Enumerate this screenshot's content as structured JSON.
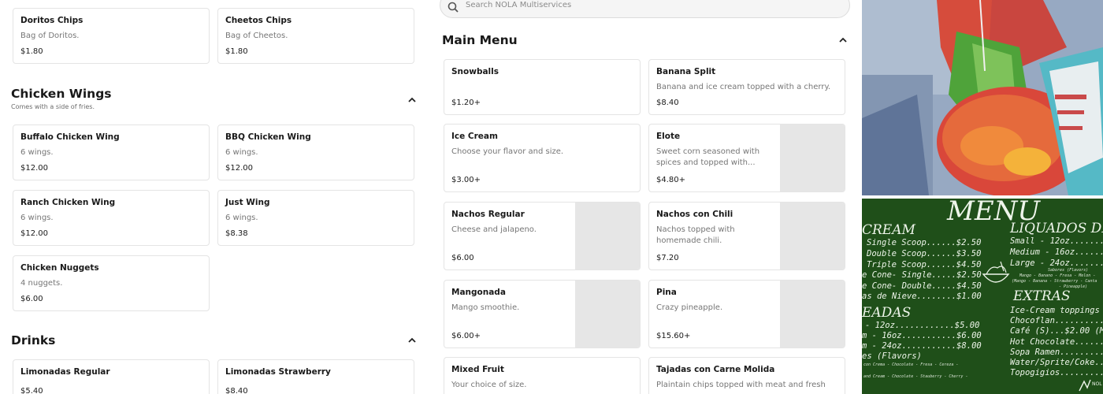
{
  "search": {
    "placeholder": "Search NOLA Multiservices"
  },
  "left": {
    "chips": [
      {
        "name": "Doritos Chips",
        "desc": "Bag of Doritos.",
        "price": "$1.80"
      },
      {
        "name": "Cheetos Chips",
        "desc": "Bag of Cheetos.",
        "price": "$1.80"
      }
    ],
    "wings_section": {
      "title": "Chicken Wings",
      "subtitle": "Comes with a side of fries."
    },
    "wings": [
      {
        "name": "Buffalo Chicken Wing",
        "desc": "6 wings.",
        "price": "$12.00"
      },
      {
        "name": "BBQ Chicken Wing",
        "desc": "6 wings.",
        "price": "$12.00"
      },
      {
        "name": "Ranch Chicken Wing",
        "desc": "6 wings.",
        "price": "$12.00"
      },
      {
        "name": "Just Wing",
        "desc": "6 wings.",
        "price": "$8.38"
      },
      {
        "name": "Chicken Nuggets",
        "desc": "4 nuggets.",
        "price": "$6.00"
      }
    ],
    "drinks_section": {
      "title": "Drinks"
    },
    "drinks": [
      {
        "name": "Limonadas Regular",
        "price": "$5.40"
      },
      {
        "name": "Limonadas Strawberry",
        "price": "$8.40"
      }
    ]
  },
  "main_menu": {
    "title": "Main Menu",
    "items": [
      {
        "name": "Snowballs",
        "desc": "",
        "price": "$1.20+"
      },
      {
        "name": "Banana Split",
        "desc": "Banana and ice cream topped with a cherry.",
        "price": "$8.40"
      },
      {
        "name": "Ice Cream",
        "desc": "Choose your flavor and size.",
        "price": "$3.00+"
      },
      {
        "name": "Elote",
        "desc": "Sweet corn seasoned with spices and topped with...",
        "price": "$4.80+"
      },
      {
        "name": "Nachos Regular",
        "desc": "Cheese and jalapeno.",
        "price": "$6.00"
      },
      {
        "name": "Nachos con Chili",
        "desc": "Nachos topped with homemade chili.",
        "price": "$7.20"
      },
      {
        "name": "Mangonada",
        "desc": "Mango smoothie.",
        "price": "$6.00+"
      },
      {
        "name": "Pina",
        "desc": "Crazy pineapple.",
        "price": "$15.60+"
      },
      {
        "name": "Mixed Fruit",
        "desc": "Your choice of size.",
        "price": ""
      },
      {
        "name": "Tajadas con Carne Molida",
        "desc": "Plaintain chips topped with meat and fresh",
        "price": ""
      }
    ]
  },
  "chalkboard": {
    "title": "MENU",
    "col1_head": "CREAM",
    "col1_lines": [
      "Single Scoop......$2.50",
      "Double Scoop......$3.50",
      "Triple Scoop......$4.50",
      "e Cone- Single.....$2.50",
      "e Cone- Double.....$4.50",
      "as de Nieve........$1.00"
    ],
    "col1_head2": "EADAS",
    "col1_lines2": [
      "- 12oz............$5.00",
      "m - 16oz...........$6.00",
      "m - 24oz...........$8.00",
      "es (Flavors)"
    ],
    "col1_tiny": [
      "con Crema - Chocolate - Fresa - Cereza -",
      "and Cream - Chocolate - Stauberry - Cherry -"
    ],
    "col2_head": "LIQUADOS DE",
    "col2_lines": [
      "Small - 12oz.......",
      "Medium - 16oz......",
      "Large - 24oz.......",
      "Sabores (Flavors)"
    ],
    "col2_tiny": [
      "Mango - Banano - Fresa - Melon -",
      "(Mango - Banana - Strawberry - Canta",
      "- Pineapple)"
    ],
    "col2_head2": "EXTRAS",
    "col2_lines2": [
      "Ice-Cream toppings (",
      "Chocoflan..........",
      "Café (S)...$2.00 (M).",
      "Hot Chocolate.......",
      "Sopa Ramen.........",
      "Water/Sprite/Coke...",
      "Topogigios........."
    ],
    "logo_text": "NOL"
  }
}
